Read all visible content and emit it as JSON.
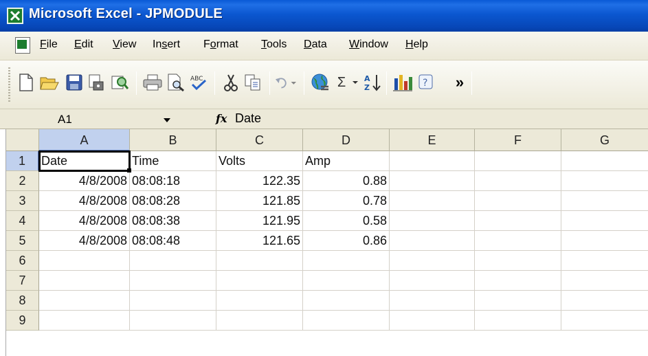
{
  "window": {
    "title": "Microsoft Excel - JPMODULE"
  },
  "menu": [
    {
      "label": "File",
      "accel": "F"
    },
    {
      "label": "Edit",
      "accel": "E"
    },
    {
      "label": "View",
      "accel": "V"
    },
    {
      "label": "Insert",
      "accel": "s"
    },
    {
      "label": "Format",
      "accel": "o"
    },
    {
      "label": "Tools",
      "accel": "T"
    },
    {
      "label": "Data",
      "accel": "D"
    },
    {
      "label": "Window",
      "accel": "W"
    },
    {
      "label": "Help",
      "accel": "H"
    }
  ],
  "toolbar": {
    "buttons": [
      "new-icon",
      "open-icon",
      "save-icon",
      "permission-icon",
      "research-icon",
      "print-icon",
      "print-preview-icon",
      "spelling-icon",
      "cut-icon",
      "copy-icon",
      "undo-icon",
      "hyperlink-icon",
      "autosum-icon",
      "sort-ascending-icon",
      "chart-wizard-icon",
      "help-icon",
      "overflow-icon"
    ],
    "autosum_glyph": "Σ",
    "overflow_glyph": "»"
  },
  "formula_bar": {
    "name_box": "A1",
    "fx_label": "fx",
    "value": "Date"
  },
  "sheet": {
    "columns": [
      "A",
      "B",
      "C",
      "D",
      "E",
      "F",
      "G"
    ],
    "active_column": "A",
    "active_row": "1",
    "rows": [
      {
        "num": "1",
        "cells": [
          "Date",
          "Time",
          "Volts",
          "Amp",
          "",
          "",
          ""
        ]
      },
      {
        "num": "2",
        "cells": [
          "4/8/2008",
          "08:08:18",
          "122.35",
          "0.88",
          "",
          "",
          ""
        ]
      },
      {
        "num": "3",
        "cells": [
          "4/8/2008",
          "08:08:28",
          "121.85",
          "0.78",
          "",
          "",
          ""
        ]
      },
      {
        "num": "4",
        "cells": [
          "4/8/2008",
          "08:08:38",
          "121.95",
          "0.58",
          "",
          "",
          ""
        ]
      },
      {
        "num": "5",
        "cells": [
          "4/8/2008",
          "08:08:48",
          "121.65",
          "0.86",
          "",
          "",
          ""
        ]
      },
      {
        "num": "6",
        "cells": [
          "",
          "",
          "",
          "",
          "",
          "",
          ""
        ]
      },
      {
        "num": "7",
        "cells": [
          "",
          "",
          "",
          "",
          "",
          "",
          ""
        ]
      },
      {
        "num": "8",
        "cells": [
          "",
          "",
          "",
          "",
          "",
          "",
          ""
        ]
      },
      {
        "num": "9",
        "cells": [
          "",
          "",
          "",
          "",
          "",
          "",
          ""
        ]
      }
    ]
  }
}
